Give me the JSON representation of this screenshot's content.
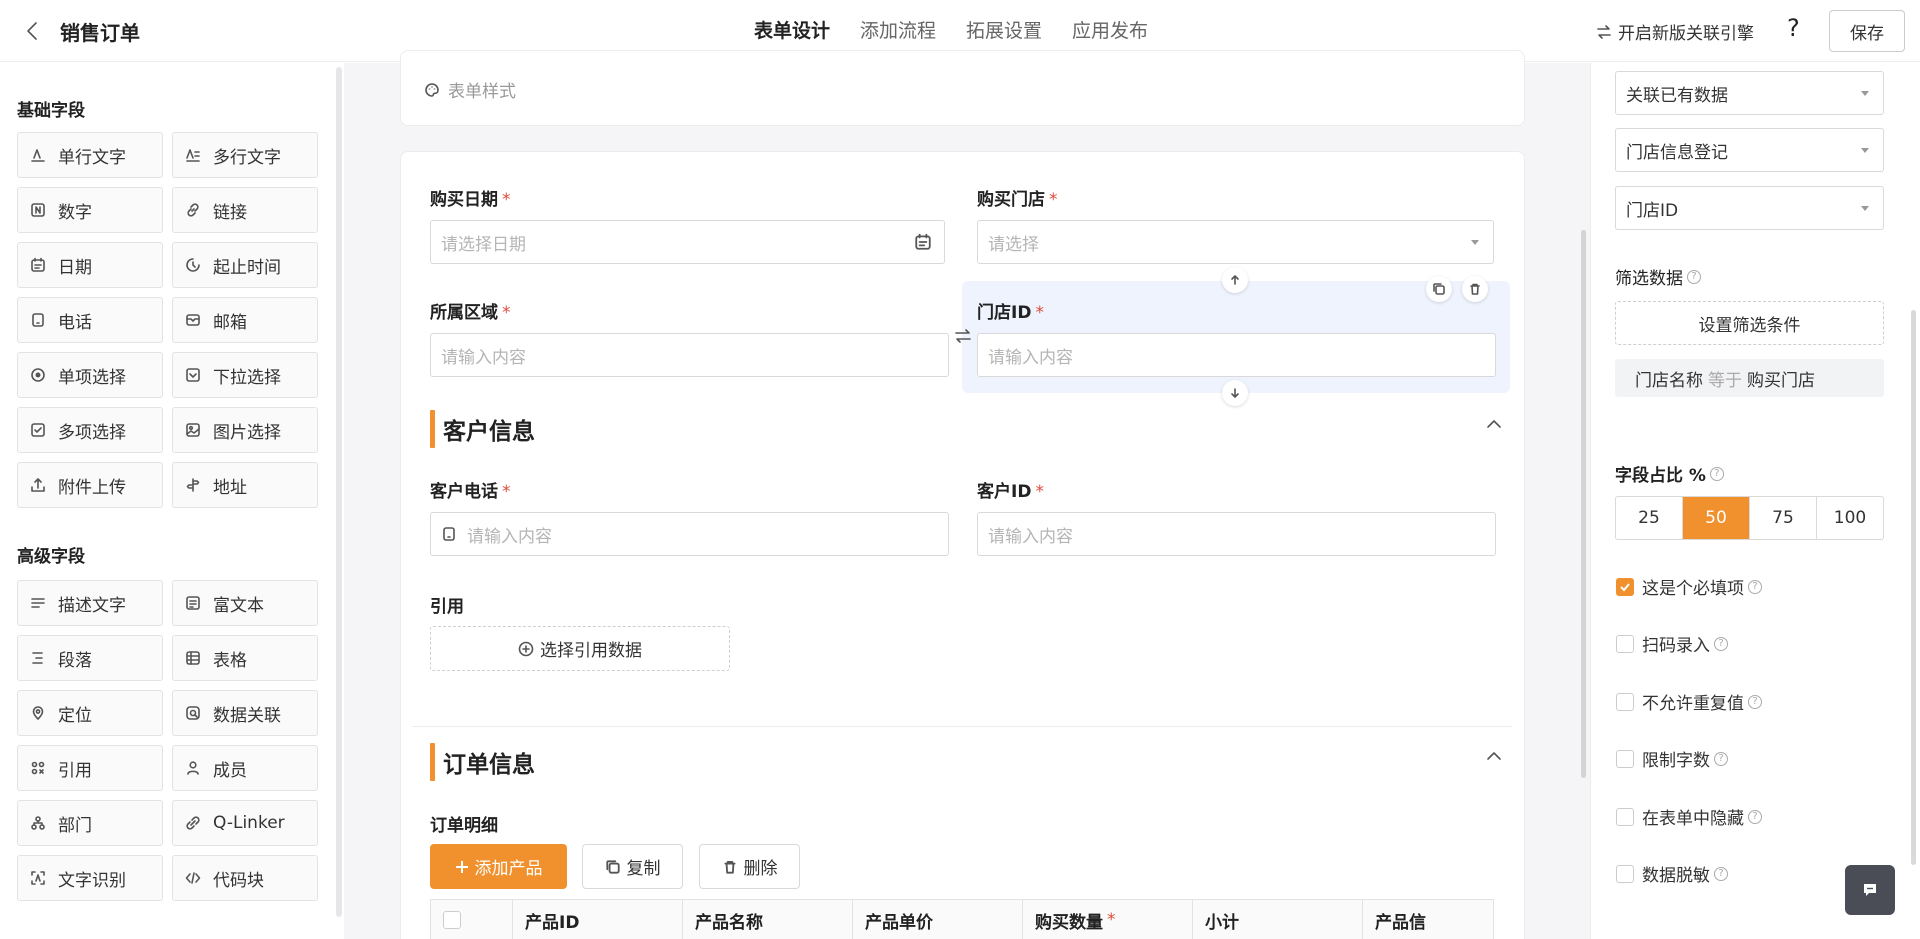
{
  "header": {
    "title": "销售订单",
    "tabs": [
      "表单设计",
      "添加流程",
      "拓展设置",
      "应用发布"
    ],
    "engine_label": "开启新版关联引擎",
    "help": "?",
    "save_label": "保存"
  },
  "palette": {
    "basic_title": "基础字段",
    "basic": [
      "单行文字",
      "多行文字",
      "数字",
      "链接",
      "日期",
      "起止时间",
      "电话",
      "邮箱",
      "单项选择",
      "下拉选择",
      "多项选择",
      "图片选择",
      "附件上传",
      "地址"
    ],
    "advanced_title": "高级字段",
    "advanced": [
      "描述文字",
      "富文本",
      "段落",
      "表格",
      "定位",
      "数据关联",
      "引用",
      "成员",
      "部门",
      "Q-Linker",
      "文字识别",
      "代码块"
    ]
  },
  "form": {
    "style_label": "表单样式",
    "purchase_date": {
      "label": "购买日期",
      "placeholder": "请选择日期"
    },
    "purchase_store": {
      "label": "购买门店",
      "placeholder": "请选择"
    },
    "region": {
      "label": "所属区域",
      "placeholder": "请输入内容"
    },
    "store_id": {
      "label": "门店ID",
      "placeholder": "请输入内容"
    },
    "customer_section": "客户信息",
    "customer_phone": {
      "label": "客户电话",
      "placeholder": "请输入内容"
    },
    "customer_id": {
      "label": "客户ID",
      "placeholder": "请输入内容"
    },
    "reference": {
      "label": "引用",
      "button": "选择引用数据"
    },
    "order_section": "订单信息",
    "order_detail_label": "订单明细",
    "add_product": "添加产品",
    "copy": "复制",
    "delete": "删除",
    "table_columns": [
      "产品ID",
      "产品名称",
      "产品单价",
      "购买数量",
      "小计",
      "产品信"
    ],
    "required_mark": "*"
  },
  "props": {
    "selects": [
      "关联已有数据",
      "门店信息登记",
      "门店ID"
    ],
    "filter_label": "筛选数据",
    "filter_button": "设置筛选条件",
    "condition": {
      "field": "门店名称",
      "op": "等于",
      "value": "购买门店"
    },
    "width_label": "字段占比 %",
    "width_options": [
      "25",
      "50",
      "75",
      "100"
    ],
    "width_selected": "50",
    "options": [
      {
        "label": "这是个必填项",
        "checked": true
      },
      {
        "label": "扫码录入",
        "checked": false
      },
      {
        "label": "不允许重复值",
        "checked": false
      },
      {
        "label": "限制字数",
        "checked": false
      },
      {
        "label": "在表单中隐藏",
        "checked": false
      },
      {
        "label": "数据脱敏",
        "checked": false
      }
    ]
  },
  "colors": {
    "accent": "#f0912e",
    "selected_bg": "#eef3fd",
    "required": "#e04b3a"
  }
}
